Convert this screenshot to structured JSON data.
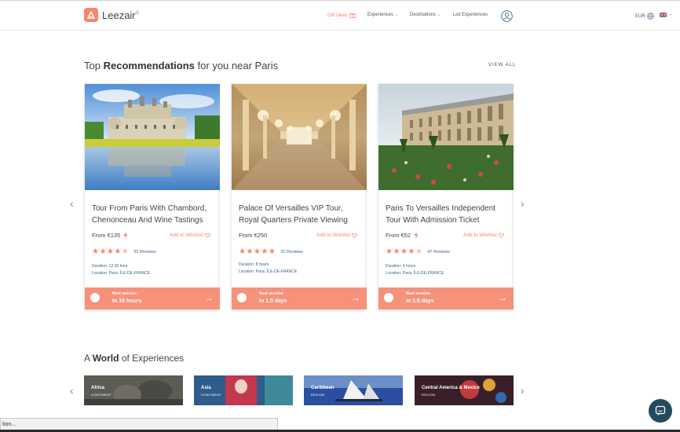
{
  "header": {
    "logo_text": "Leezair",
    "logo_mark": "®",
    "nav": {
      "gift_ideas": "Gift Ideas",
      "experiences": "Experiences",
      "destinations": "Destinations",
      "list_experiences": "List Experiences"
    },
    "currency": "EUR",
    "icons": [
      "gift-icon",
      "user-icon",
      "globe-icon",
      "uk-flag-icon"
    ]
  },
  "recommendations": {
    "title_prefix": "Top",
    "title_bold": "Recommendations",
    "title_suffix": "for you near Paris",
    "view_all": "VIEW ALL",
    "cards": [
      {
        "title": "Tour From Paris With Chambord, Chenonceau And Wine Tastings",
        "price": "From €135",
        "wishlist": "Add to Wishlist",
        "rating": 4.5,
        "reviews": "52 Reviews",
        "duration": "Duration: 12:30 hour",
        "location": "Location: Paris, ÎLE-DE-FRANCE",
        "session_label": "Next session",
        "session_time": "In 10 hours",
        "image": "castle-photo",
        "instant": true
      },
      {
        "title": "Palace Of Versailles VIP Tour, Royal Quarters Private Viewing",
        "price": "From €250",
        "wishlist": "Add to Wishlist",
        "rating": 5,
        "reviews": "31 Reviews",
        "duration": "Duration: 8 hours",
        "location": "Location: Paris, ÎLE-DE-FRANCE",
        "session_label": "Next session",
        "session_time": "In 1.5 days",
        "image": "hall-of-mirrors-photo",
        "instant": false
      },
      {
        "title": "Paris To Versailles Independent Tour With Admission Ticket",
        "price": "From €62",
        "wishlist": "Add to Wishlist",
        "rating": 4.5,
        "reviews": "47 Reviews",
        "duration": "Duration: 4 hours",
        "location": "Location: Paris, ÎLE-DE-FRANCE",
        "session_label": "Next session",
        "session_time": "In 1.5 days",
        "image": "versailles-palace-photo",
        "instant": true
      }
    ]
  },
  "world": {
    "title_prefix": "A",
    "title_bold": "World",
    "title_suffix": "of Experiences",
    "tiles": [
      {
        "name": "Africa",
        "sub": "CONTINENT"
      },
      {
        "name": "Asia",
        "sub": "CONTINENT"
      },
      {
        "name": "Caribbean",
        "sub": "REGION"
      },
      {
        "name": "Central America & Mexico",
        "sub": "REGION"
      }
    ]
  },
  "status_bar": "tion...",
  "colors": {
    "accent": "#f6856a",
    "session": "#f6917a",
    "meta": "#3f5f8a",
    "chat": "#234b5e"
  }
}
